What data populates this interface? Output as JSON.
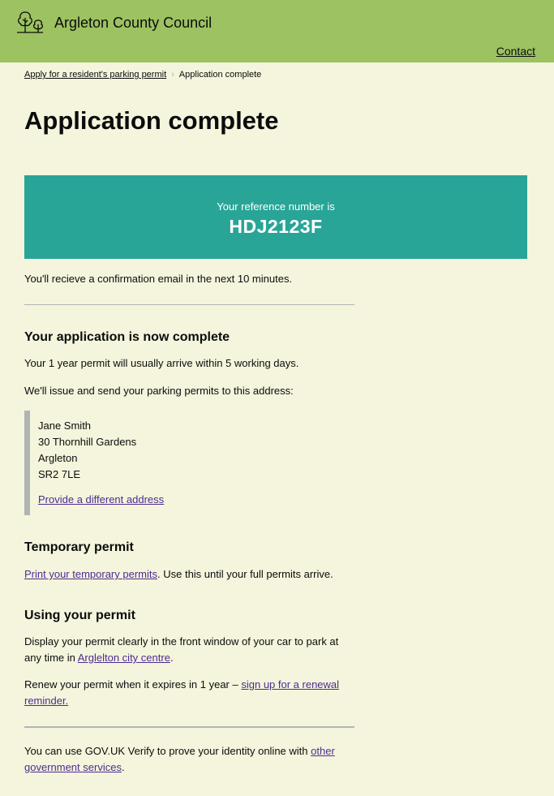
{
  "header": {
    "org_name": "Argleton County Council",
    "logo_icon": "trees-icon",
    "contact_label": "Contact",
    "brand_color": "#9dc261"
  },
  "breadcrumb": {
    "parent": "Apply for a resident's parking permit",
    "current": "Application complete"
  },
  "page": {
    "title": "Application complete"
  },
  "panel": {
    "lead": "Your reference number is",
    "reference": "HDJ2123F",
    "color": "#28a597"
  },
  "confirmation_text": "You'll recieve a confirmation email in the next 10 minutes.",
  "complete": {
    "heading": "Your application is now complete",
    "arrival_text": "Your 1 year permit will usually arrive within 5 working days.",
    "address_intro": "We'll issue and send your parking permits to this address:",
    "address": [
      "Jane Smith",
      "30 Thornhill Gardens",
      "Argleton",
      "SR2 7LE"
    ],
    "change_address_link": "Provide a different address"
  },
  "temporary": {
    "heading": "Temporary permit",
    "link": "Print your temporary permits",
    "rest": ". Use this until your full permits arrive."
  },
  "using": {
    "heading": "Using your permit",
    "display_text": "Display your permit clearly in the front window of your car to park at any time in ",
    "display_link": "Arglelton city centre",
    "display_end": ".",
    "renew_text": "Renew your permit when it expires in 1 year – ",
    "renew_link": "sign up for a renewal reminder."
  },
  "footer_note": {
    "text": "You can use GOV.UK Verify to prove your identity online with ",
    "link": "other government services",
    "end": "."
  }
}
